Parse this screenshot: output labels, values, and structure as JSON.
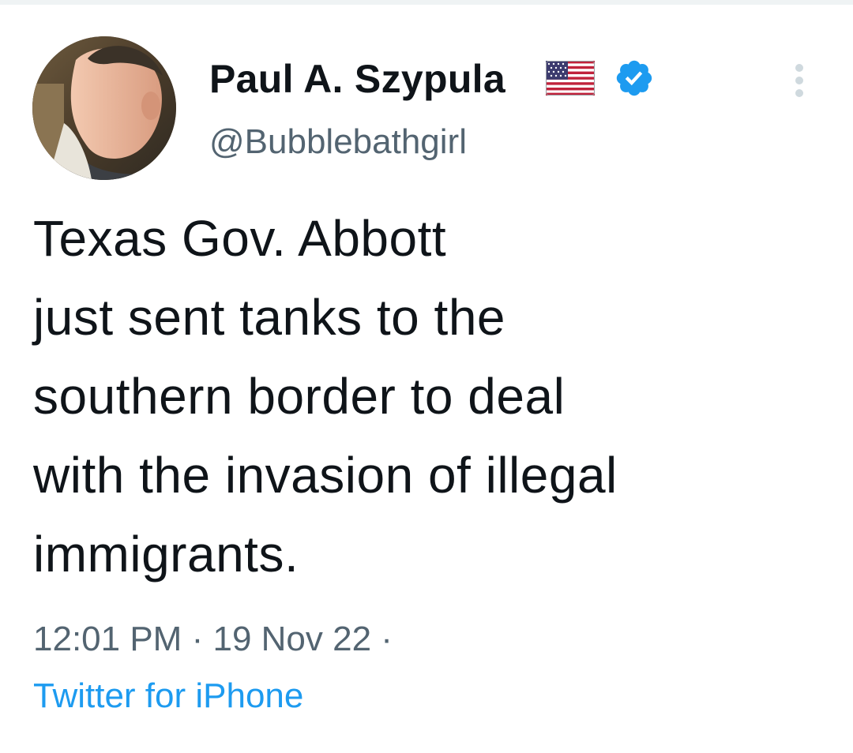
{
  "tweet": {
    "display_name": "Paul A. Szypula",
    "handle": "@Bubblebathgirl",
    "flag_icon": "us-flag-icon",
    "verified_icon": "verified-badge-icon",
    "more_icon": "more-options-icon",
    "text": "Texas Gov. Abbott\njust sent tanks to the\nsouthern border to deal\nwith the invasion of illegal\nimmigrants.",
    "time": "12:01 PM",
    "date": "19 Nov 22",
    "separator": "·",
    "source": "Twitter for iPhone"
  },
  "colors": {
    "text": "#0f1419",
    "secondary": "#536471",
    "accent": "#1d9bf0"
  }
}
